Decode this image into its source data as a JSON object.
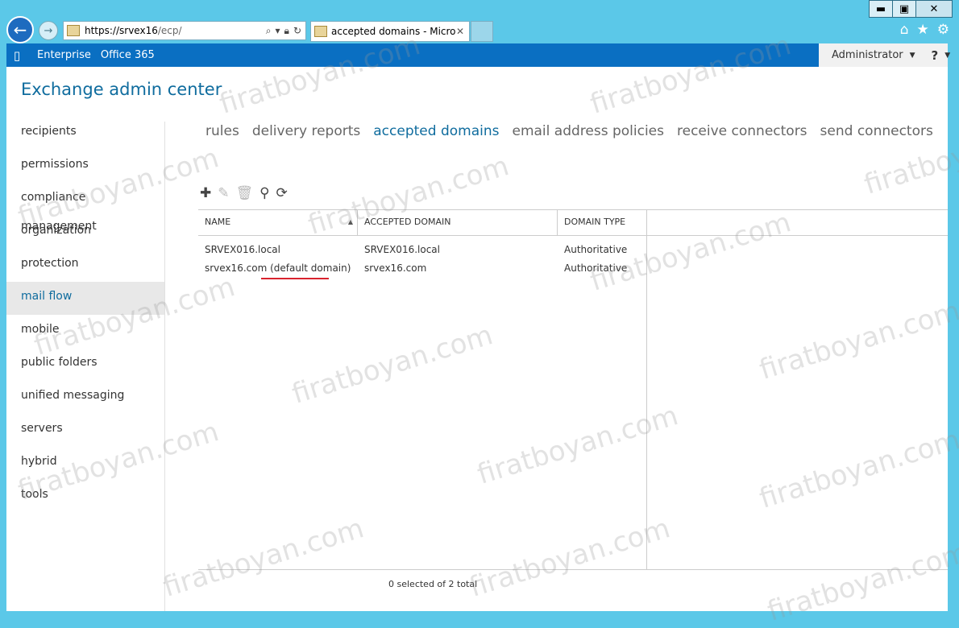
{
  "browser": {
    "url_host": "https://srvex16",
    "url_path": "/ecp/",
    "tab_title": "accepted domains - Micros...",
    "window_controls": {
      "minimize": "▬",
      "maximize": "▣",
      "close": "✕"
    }
  },
  "appbar": {
    "links": [
      "Enterprise",
      "Office 365"
    ],
    "user": "Administrator",
    "help": "?"
  },
  "app_title": "Exchange admin center",
  "nav": [
    "recipients",
    "permissions",
    "compliance management",
    "organization",
    "protection",
    "mail flow",
    "mobile",
    "public folders",
    "unified messaging",
    "servers",
    "hybrid",
    "tools"
  ],
  "tabs": [
    "rules",
    "delivery reports",
    "accepted domains",
    "email address policies",
    "receive connectors",
    "send connectors"
  ],
  "table": {
    "headers": [
      "NAME",
      "ACCEPTED DOMAIN",
      "DOMAIN TYPE"
    ],
    "rows": [
      [
        "SRVEX016.local",
        "SRVEX016.local",
        "Authoritative"
      ],
      [
        "srvex16.com (default domain)",
        "srvex16.com",
        "Authoritative"
      ]
    ]
  },
  "status": "0 selected of 2 total",
  "watermark": "firatboyan.com",
  "colors": {
    "accent": "#0f6c9e",
    "appbar": "#0a6fc2",
    "underline": "#d9232e"
  }
}
